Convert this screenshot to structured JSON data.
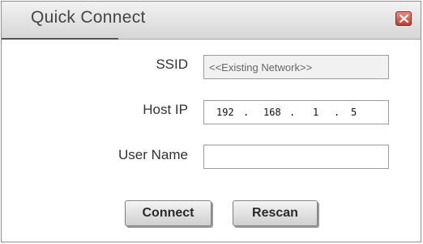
{
  "window": {
    "title": "Quick Connect"
  },
  "form": {
    "ssid_label": "SSID",
    "ssid_value": "<<Existing Network>>",
    "hostip_label": "Host IP",
    "hostip_segments": [
      "192",
      "168",
      "1",
      "5"
    ],
    "hostip_separator": ".",
    "username_label": "User Name",
    "username_value": ""
  },
  "buttons": {
    "connect_label": "Connect",
    "rescan_label": "Rescan"
  },
  "icons": {
    "close": "close-icon"
  },
  "colors": {
    "close_button": "#d9534f",
    "title_bar": "#e4e4e4"
  }
}
